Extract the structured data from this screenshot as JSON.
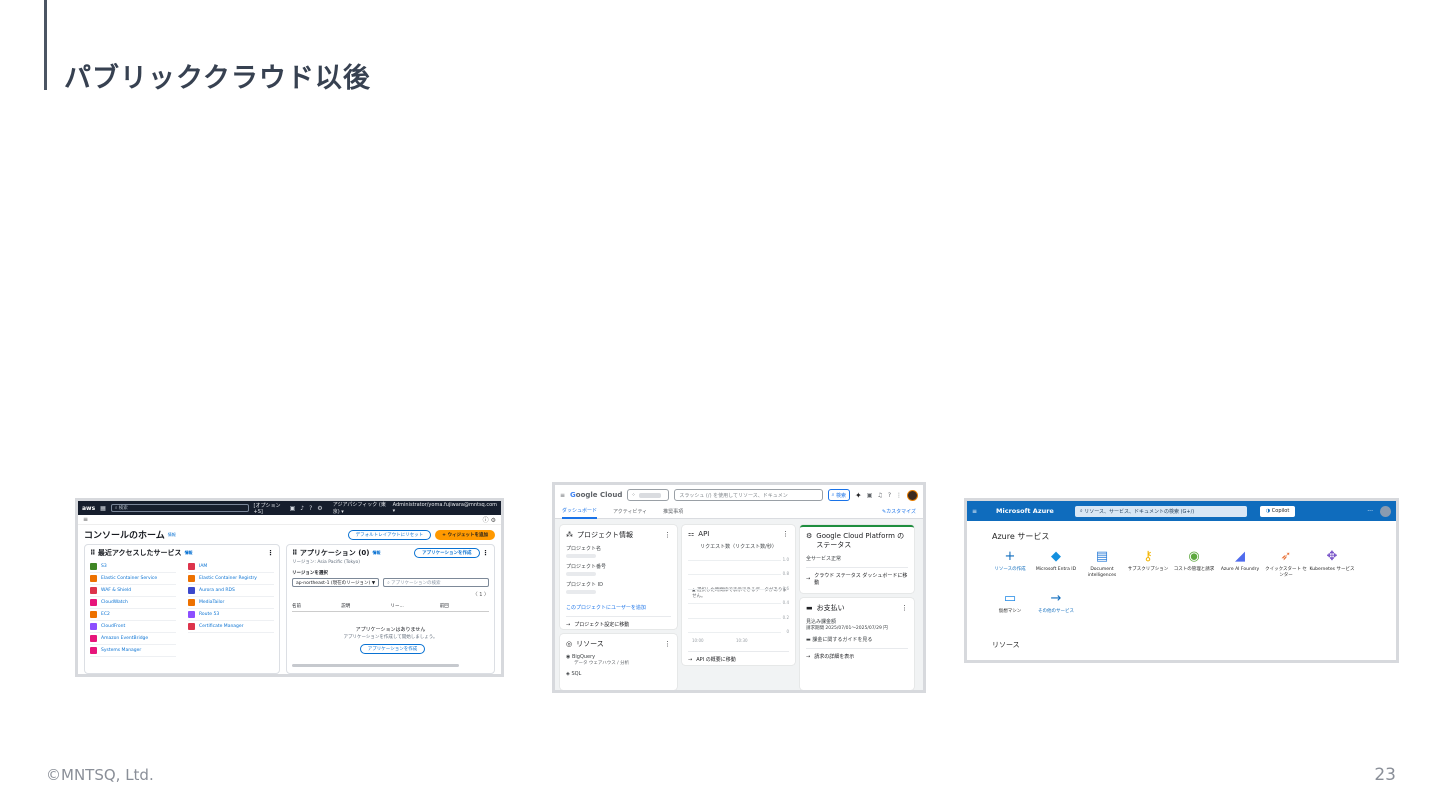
{
  "slide": {
    "title": "パブリッククラウド以後",
    "footer": "©MNTSQ, Ltd.",
    "page_number": "23"
  },
  "aws": {
    "logo": "aws",
    "search_placeholder": "検索",
    "search_shortcut": "[オプション+S]",
    "region": "アジアパシフィック (東京) ▾",
    "account": "Administrator/yoma.fujiwara@mntsq.com ▾",
    "home_title": "コンソールのホーム",
    "info": "情報",
    "reset_button": "デフォルトレイアウトにリセット",
    "add_widget_button": "+ ウィジェットを追加",
    "recent_title": "最近アクセスしたサービス",
    "services_left": [
      {
        "name": "S3",
        "color": "#3f8624"
      },
      {
        "name": "Elastic Container Service",
        "color": "#ed7100"
      },
      {
        "name": "WAF & Shield",
        "color": "#dd344c"
      },
      {
        "name": "CloudWatch",
        "color": "#e7157b"
      },
      {
        "name": "EC2",
        "color": "#ed7100"
      },
      {
        "name": "CloudFront",
        "color": "#8c4fff"
      },
      {
        "name": "Amazon EventBridge",
        "color": "#e7157b"
      },
      {
        "name": "Systems Manager",
        "color": "#e7157b"
      }
    ],
    "services_right": [
      {
        "name": "IAM",
        "color": "#dd344c"
      },
      {
        "name": "Elastic Container Registry",
        "color": "#ed7100"
      },
      {
        "name": "Aurora and RDS",
        "color": "#3b48cc"
      },
      {
        "name": "MediaTailor",
        "color": "#ed7100"
      },
      {
        "name": "Route 53",
        "color": "#8c4fff"
      },
      {
        "name": "Certificate Manager",
        "color": "#dd344c"
      }
    ],
    "apps_title": "アプリケーション (0)",
    "create_app_button": "アプリケーションを作成",
    "region_line": "リージョン: Asia Pacific (Tokyo)",
    "region_select_label": "リージョンを選択",
    "region_select_value": "ap-northeast-1 (現在のリージョン) ▼",
    "find_apps_placeholder": "アプリケーションの検索",
    "pager": "〈 1 〉",
    "columns": [
      "名前",
      "説明",
      "リー...",
      "前回"
    ],
    "empty_title": "アプリケーションはありません",
    "empty_desc": "アプリケーションを作成して開始しましょう。",
    "empty_button": "アプリケーションを作成"
  },
  "gcp": {
    "logo": "Google Cloud",
    "search_placeholder": "スラッシュ (/) を使用してリソース、ドキュメン",
    "search_button": "検索",
    "tabs": [
      "ダッシュボード",
      "アクティビティ",
      "推奨事項"
    ],
    "customize": "カスタマイズ",
    "project_card": {
      "title": "プロジェクト情報",
      "fields": [
        "プロジェクト名",
        "プロジェクト番号",
        "プロジェクト ID"
      ],
      "add_user_link": "このプロジェクトにユーザーを追加",
      "settings_link": "プロジェクト設定に移動"
    },
    "api_card": {
      "title": "API",
      "chart_title": "リクエスト数（リクエスト数/秒）",
      "no_data": "選択した時間枠で表示できるデータがありません。",
      "yticks": [
        "1.0",
        "0.8",
        "0.6",
        "0.4",
        "0.2",
        "0"
      ],
      "xticks": [
        "10:00",
        "10:30"
      ],
      "overview_link": "API の概要に移動"
    },
    "resources_card": {
      "title": "リソース",
      "items": [
        "BigQuery",
        "データ ウェアハウス / 分析",
        "SQL"
      ]
    },
    "status_card": {
      "title": "Google Cloud Platform のステータス",
      "status": "全サービス正常",
      "link": "クラウド ステータス ダッシュボードに移動"
    },
    "billing_card": {
      "title": "お支払い",
      "estimated": "見込み課金額",
      "period": "請求期間 2025/07/01～2025/07/29 円",
      "guide_link": "課金に関するガイドを見る",
      "details_link": "請求の詳細を表示"
    }
  },
  "azure": {
    "brand": "Microsoft Azure",
    "search_placeholder": "リソース、サービス、ドキュメントの検索 (G+/)",
    "copilot": "Copilot",
    "services_heading": "Azure サービス",
    "services": [
      {
        "label": "リソースの作成",
        "icon": "plus-icon",
        "link": true
      },
      {
        "label": "Microsoft Entra ID",
        "icon": "entra-icon",
        "link": false
      },
      {
        "label": "Document intelligences",
        "icon": "document-icon",
        "link": false
      },
      {
        "label": "サブスクリプション",
        "icon": "key-icon",
        "link": false
      },
      {
        "label": "コストの管理と請求",
        "icon": "cost-icon",
        "link": false
      },
      {
        "label": "Azure AI Foundry",
        "icon": "foundry-icon",
        "link": false
      },
      {
        "label": "クイックスタート センター",
        "icon": "rocket-icon",
        "link": false
      },
      {
        "label": "Kubernetes サービス",
        "icon": "kubernetes-icon",
        "link": false
      },
      {
        "label": "仮想マシン",
        "icon": "vm-icon",
        "link": false
      },
      {
        "label": "その他のサービス",
        "icon": "arrow-right-icon",
        "link": true
      }
    ],
    "resources_heading": "リソース"
  }
}
